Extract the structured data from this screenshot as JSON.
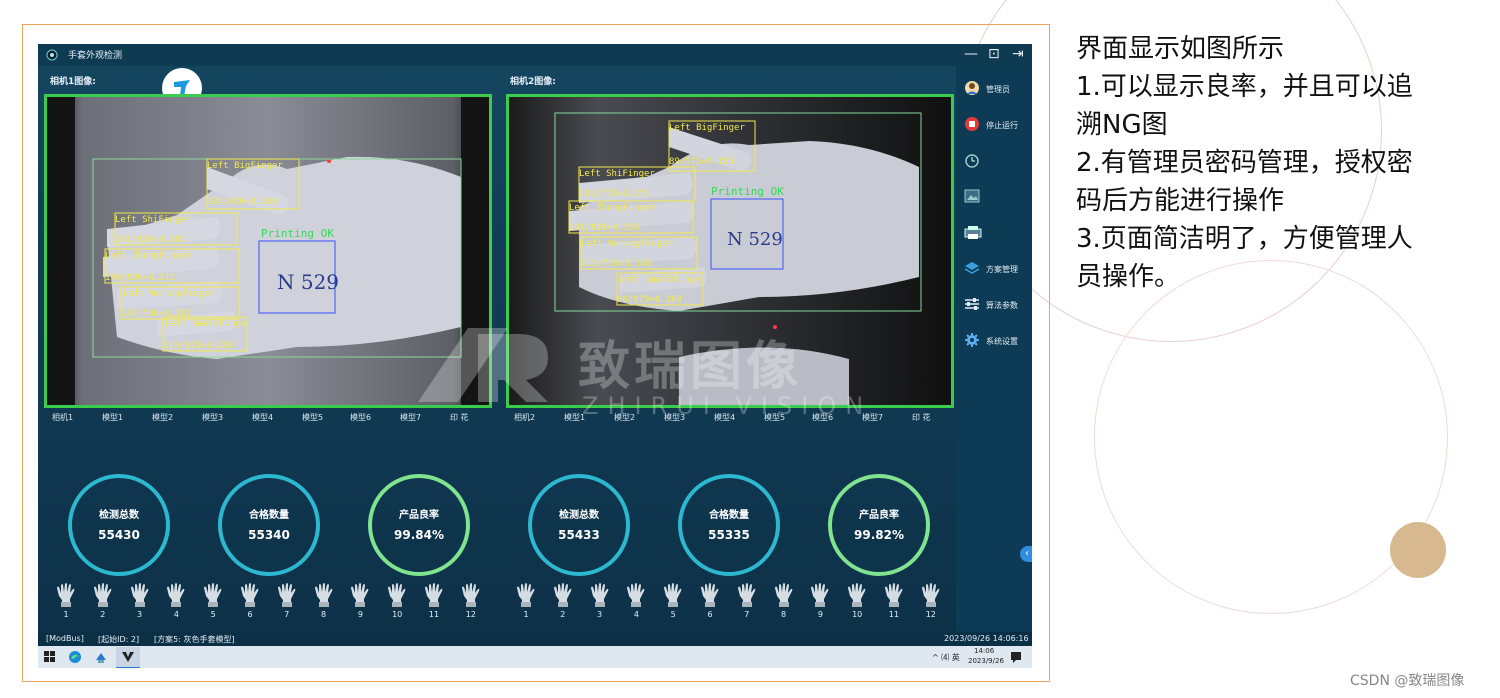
{
  "app": {
    "title": "手套外观检测",
    "window_controls": [
      "—",
      "⊡",
      "⇥"
    ]
  },
  "cameras": [
    {
      "label": "相机1图像:",
      "tabs": [
        "相机1",
        "模型1",
        "模型2",
        "模型3",
        "模型4",
        "模型5",
        "模型6",
        "模型7",
        "印 花"
      ],
      "overlays": [
        {
          "name": "Left BigFinger",
          "score": "104/620=0.168"
        },
        {
          "name": "Left ShiFinger",
          "score": "151/820=0.184"
        },
        {
          "name": "Left ZhongFinger",
          "score": "190/896=0.212"
        },
        {
          "name": "Left WumingFinger",
          "score": "147/786=0.187"
        },
        {
          "name": "Left SmallFinge",
          "score": "119/571=0.208"
        }
      ],
      "print_label": "Printing OK",
      "gauges": [
        {
          "label": "检测总数",
          "value": "55430",
          "color": "#2cb8d0"
        },
        {
          "label": "合格数量",
          "value": "55340",
          "color": "#2cb8d0"
        },
        {
          "label": "产品良率",
          "value": "99.84%",
          "color": "#7fe38f"
        }
      ],
      "slots": [
        "1",
        "2",
        "3",
        "4",
        "5",
        "6",
        "7",
        "8",
        "9",
        "10",
        "11",
        "12"
      ]
    },
    {
      "label": "相机2图像:",
      "tabs": [
        "相机2",
        "模型1",
        "模型2",
        "模型3",
        "模型4",
        "模型5",
        "模型6",
        "模型7",
        "印 花"
      ],
      "overlays": [
        {
          "name": "Left BigFinger",
          "score": "89/575=0.155"
        },
        {
          "name": "Left ShiFinger",
          "score": "132/771=0.171"
        },
        {
          "name": "Left ZhongFinger",
          "score": "131/831=0.158"
        },
        {
          "name": "Left WumingFinger",
          "score": "111/751=0.148"
        },
        {
          "name": "Left SmallFinge",
          "score": "98/579=0.169"
        }
      ],
      "print_label": "Printing OK",
      "gauges": [
        {
          "label": "检测总数",
          "value": "55433",
          "color": "#2cb8d0"
        },
        {
          "label": "合格数量",
          "value": "55335",
          "color": "#2cb8d0"
        },
        {
          "label": "产品良率",
          "value": "99.82%",
          "color": "#7fe38f"
        }
      ],
      "slots": [
        "1",
        "2",
        "3",
        "4",
        "5",
        "6",
        "7",
        "8",
        "9",
        "10",
        "11",
        "12"
      ]
    }
  ],
  "watermark": {
    "line1": "致瑞图像",
    "line2": "ZHIRUI VISION"
  },
  "sidebar": [
    {
      "label": "管理员",
      "icon": "user-icon",
      "enabled": true
    },
    {
      "label": "停止运行",
      "icon": "stop-icon",
      "enabled": true
    },
    {
      "label": "",
      "icon": "timer-icon",
      "enabled": false
    },
    {
      "label": "",
      "icon": "image-icon",
      "enabled": false
    },
    {
      "label": "",
      "icon": "printer-icon",
      "enabled": false
    },
    {
      "label": "方案管理",
      "icon": "layers-icon",
      "enabled": true
    },
    {
      "label": "算法参数",
      "icon": "sliders-icon",
      "enabled": true
    },
    {
      "label": "系统设置",
      "icon": "gear-icon",
      "enabled": true
    }
  ],
  "statusbar": {
    "protocol": "[ModBus]",
    "start_id": "[起始ID: 2]",
    "scheme": "[方案5: 灰色手套模型]",
    "datetime": "2023/09/26 14:06:16"
  },
  "taskbar": {
    "tray": "^ ⑷ 英",
    "time": "14:06",
    "date": "2023/9/26"
  },
  "notes": [
    "界面显示如图所示",
    "1.可以显示良率，并且可以追",
    "溯NG图",
    "2.有管理员密码管理，授权密",
    "码后方能进行操作",
    "3.页面简洁明了，方便管理人",
    "员操作。"
  ],
  "credit": "CSDN @致瑞图像",
  "colors": {
    "accent_green": "#3ccb4a",
    "gauge_cyan": "#2cb8d0",
    "gauge_green": "#7fe38f",
    "overlay_yellow": "#f2e94e",
    "frame_orange": "#f0a25a"
  }
}
